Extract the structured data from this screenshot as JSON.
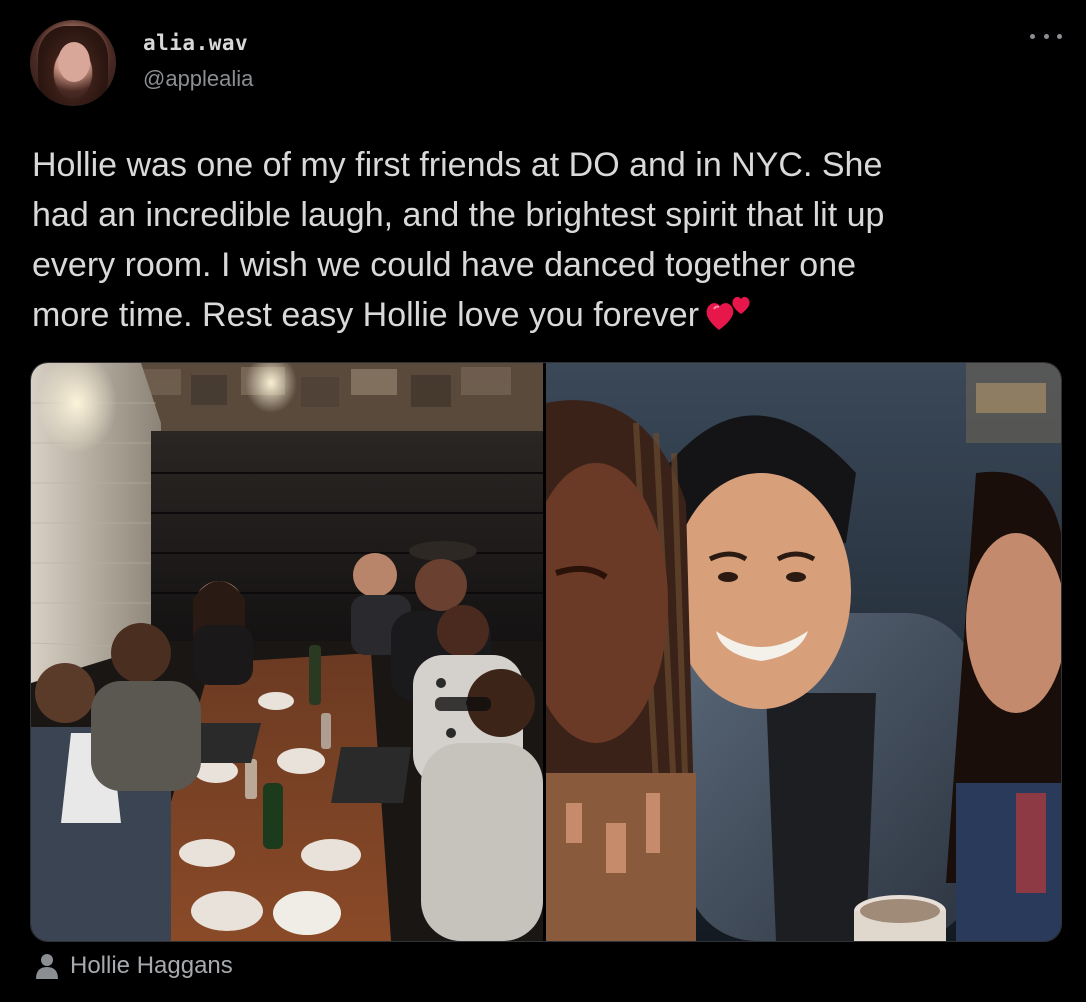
{
  "author": {
    "display_name": "alia.wav",
    "handle": "@applealia",
    "avatar_icon": "profile-avatar"
  },
  "menu": {
    "icon": "more-icon"
  },
  "tweet": {
    "lines": [
      "Hollie was one of my first friends at DO and in NYC. She",
      "had an incredible laugh, and the brightest spirit that lit up",
      "every room. I wish we could have danced together one",
      "more time. Rest easy Hollie love you forever"
    ],
    "emoji_icon": "two-hearts-emoji"
  },
  "media": {
    "photos": [
      {
        "icon": "group-dinner-photo"
      },
      {
        "icon": "selfie-photo"
      }
    ]
  },
  "tagged": {
    "icon": "person-icon",
    "label": "Hollie Haggans"
  },
  "colors": {
    "background": "#000000",
    "text": "#d9d9d9",
    "secondary": "#8b8f94",
    "heart": "#e8174b"
  }
}
